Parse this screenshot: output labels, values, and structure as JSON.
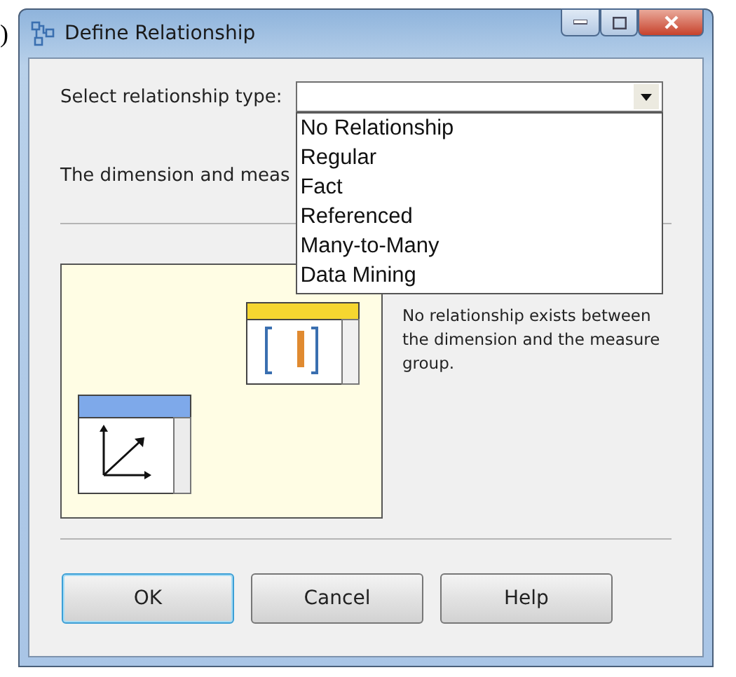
{
  "stray_text": ")",
  "window": {
    "title": "Define Relationship"
  },
  "relationship_type": {
    "label": "Select relationship type:",
    "expanded": true,
    "options": [
      {
        "label": "No Relationship",
        "selected": false
      },
      {
        "label": "Regular",
        "selected": false
      },
      {
        "label": "Fact",
        "selected": false
      },
      {
        "label": "Referenced",
        "selected": false
      },
      {
        "label": "Many-to-Many",
        "selected": false
      },
      {
        "label": "Data Mining",
        "selected": false
      }
    ]
  },
  "info_text": "The dimension and meas",
  "description": "No relationship exists between the dimension and the measure group.",
  "buttons": [
    {
      "label": "OK",
      "default": true
    },
    {
      "label": "Cancel",
      "default": false
    },
    {
      "label": "Help",
      "default": false
    }
  ]
}
